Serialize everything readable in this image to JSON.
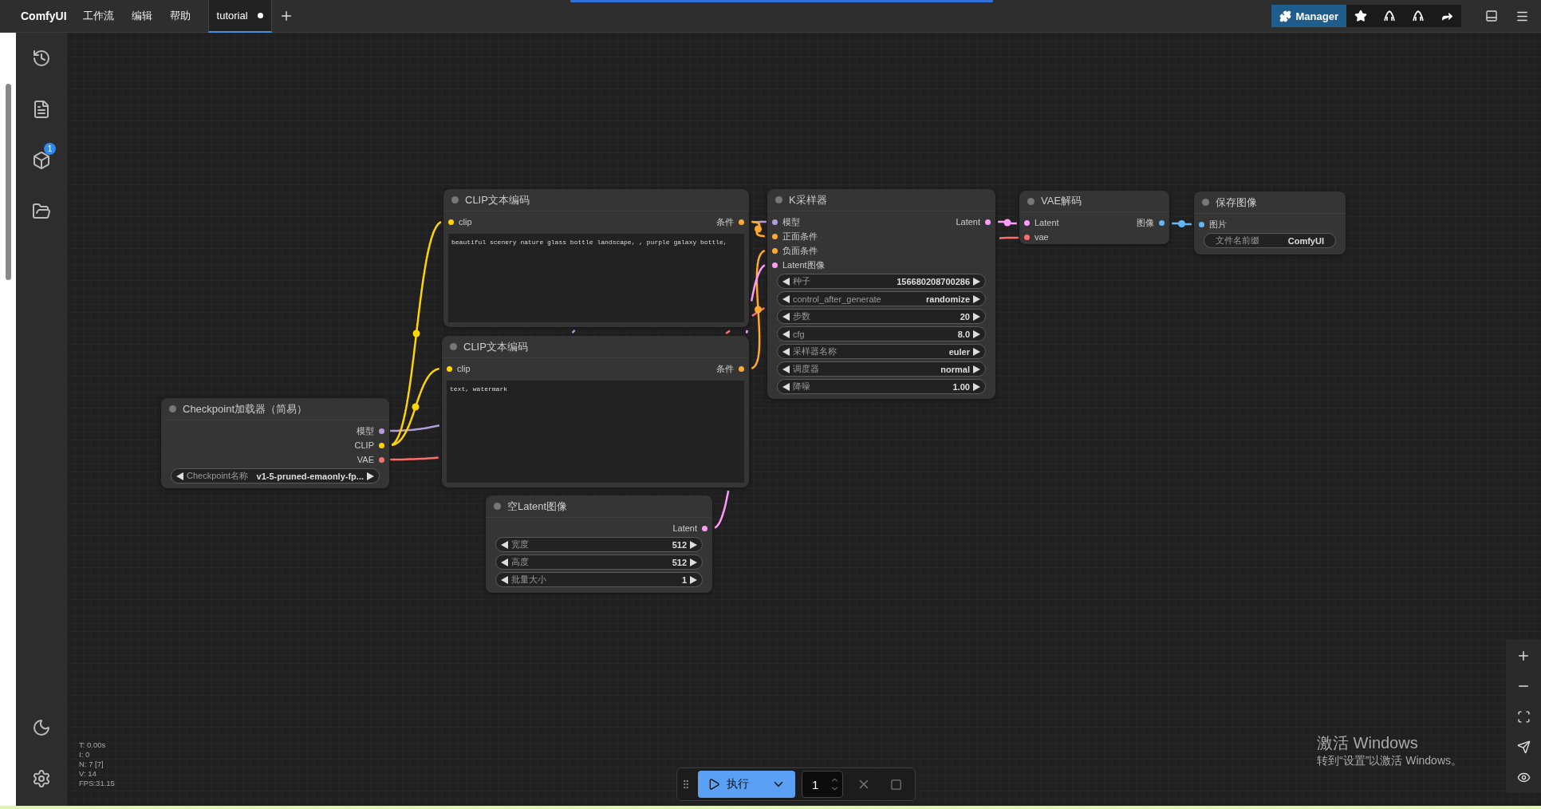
{
  "menu_bar": {
    "logo": "ComfyUI",
    "menus": [
      "工作流",
      "编辑",
      "帮助"
    ],
    "tabs": [
      {
        "label": "tutorial",
        "selected": true,
        "unsaved": true
      }
    ],
    "manager_button": "Manager"
  },
  "sidebar": {
    "queue_badge": "1"
  },
  "nodes": [
    {
      "title": "CLIP文本编码",
      "inputs": [
        {
          "label": "clip",
          "color": "#ffd500"
        }
      ],
      "outputs": [
        {
          "label": "条件",
          "color": "#ffa931"
        }
      ],
      "prompt": "beautiful scenery nature glass bottle landscape, , purple galaxy bottle,"
    },
    {
      "title": "K采样器",
      "inputs": [
        {
          "label": "模型",
          "color": "#b39ddb"
        },
        {
          "label": "正面条件",
          "color": "#ffa931"
        },
        {
          "label": "负面条件",
          "color": "#ffa931"
        },
        {
          "label": "Latent图像",
          "color": "#ff9cf9"
        }
      ],
      "outputs": [
        {
          "label": "Latent",
          "color": "#ff9cf9"
        }
      ],
      "widgets": [
        {
          "kind": "number",
          "label": "种子",
          "value": "156680208700286"
        },
        {
          "kind": "combo",
          "label": "control_after_generate",
          "value": "randomize"
        },
        {
          "kind": "number",
          "label": "步数",
          "value": "20"
        },
        {
          "kind": "number",
          "label": "cfg",
          "value": "8.0"
        },
        {
          "kind": "combo",
          "label": "采样器名称",
          "value": "euler"
        },
        {
          "kind": "combo",
          "label": "调度器",
          "value": "normal"
        },
        {
          "kind": "number",
          "label": "降噪",
          "value": "1.00"
        }
      ]
    },
    {
      "title": "VAE解码",
      "inputs": [
        {
          "label": "Latent",
          "color": "#ff9cf9"
        },
        {
          "label": "vae",
          "color": "#ff6e6e"
        }
      ],
      "outputs": [
        {
          "label": "图像",
          "color": "#64b5f6"
        }
      ]
    },
    {
      "title": "保存图像",
      "inputs": [
        {
          "label": "图片",
          "color": "#64b5f6"
        }
      ],
      "widgets": [
        {
          "kind": "text",
          "label": "文件名前缀",
          "value": "ComfyUI"
        }
      ]
    },
    {
      "title": "CLIP文本编码",
      "inputs": [
        {
          "label": "clip",
          "color": "#ffd500"
        }
      ],
      "outputs": [
        {
          "label": "条件",
          "color": "#ffa931"
        }
      ],
      "prompt": "text, watermark"
    },
    {
      "title": "Checkpoint加载器（简易）",
      "outputs": [
        {
          "label": "模型",
          "color": "#b39ddb"
        },
        {
          "label": "CLIP",
          "color": "#ffd500"
        },
        {
          "label": "VAE",
          "color": "#ff6e6e"
        }
      ],
      "widgets": [
        {
          "kind": "combo",
          "label": "Checkpoint名称",
          "value": "v1-5-pruned-emaonly-fp..."
        }
      ]
    },
    {
      "title": "空Latent图像",
      "outputs": [
        {
          "label": "Latent",
          "color": "#ff9cf9"
        }
      ],
      "widgets": [
        {
          "kind": "number",
          "label": "宽度",
          "value": "512"
        },
        {
          "kind": "number",
          "label": "高度",
          "value": "512"
        },
        {
          "kind": "number",
          "label": "批量大小",
          "value": "1"
        }
      ]
    }
  ],
  "stats": [
    "T: 0.00s",
    "I: 0",
    "N: 7 [7]",
    "V: 14",
    "FPS:31.15"
  ],
  "run_toolbar": {
    "run_label": "执行",
    "batch_count": "1"
  },
  "os_notice": {
    "title": "激活 Windows",
    "subtitle": "转到“设置”以激活 Windows。"
  }
}
